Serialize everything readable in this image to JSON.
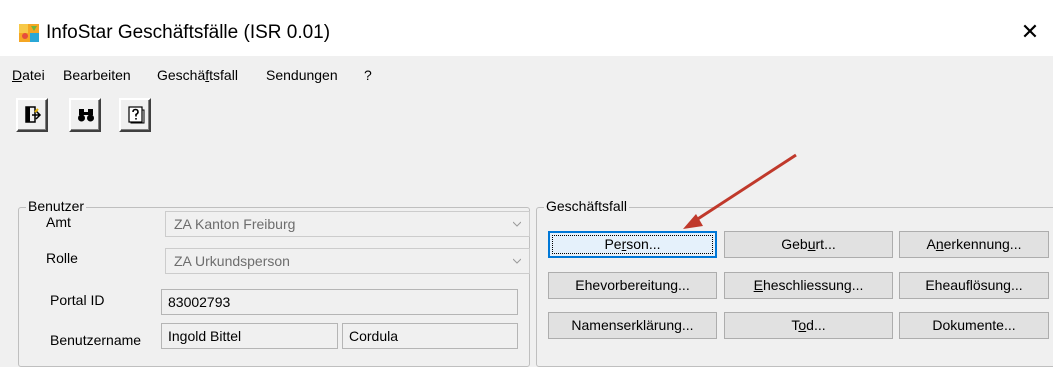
{
  "window": {
    "title": "InfoStar Geschäftsfälle (ISR 0.01)",
    "close_symbol": "✕",
    "app_icon": "infostar-app-icon"
  },
  "menu": {
    "items": [
      {
        "label": "Datei",
        "mnemonic": "D"
      },
      {
        "label": "Bearbeiten",
        "mnemonic": ""
      },
      {
        "label": "Geschäftsfall",
        "mnemonic": "f"
      },
      {
        "label": "Sendungen",
        "mnemonic": ""
      },
      {
        "label": "?",
        "mnemonic": ""
      }
    ]
  },
  "toolbar": {
    "buttons": [
      {
        "icon": "exit-door-icon"
      },
      {
        "icon": "binoculars-search-icon"
      },
      {
        "icon": "help-icon"
      }
    ]
  },
  "benutzer": {
    "legend": "Benutzer",
    "amt_label": "Amt",
    "amt_value": "ZA Kanton Freiburg",
    "rolle_label": "Rolle",
    "rolle_value": "ZA Urkundsperson",
    "portal_id_label": "Portal ID",
    "portal_id_value": "83002793",
    "benutzername_label": "Benutzername",
    "benutzername_last": "Ingold Bittel",
    "benutzername_first": "Cordula"
  },
  "geschaeftsfall": {
    "legend": "Geschäftsfall",
    "buttons": [
      {
        "label": "Person...",
        "mnemonic_index": 2
      },
      {
        "label": "Geburt...",
        "mnemonic_index": 3
      },
      {
        "label": "Anerkennung...",
        "mnemonic_index": 1
      },
      {
        "label": "Ehevorbereitung...",
        "mnemonic_index": -1
      },
      {
        "label": "Eheschliessung...",
        "mnemonic_index": 0
      },
      {
        "label": "Eheauflösung...",
        "mnemonic_index": -1
      },
      {
        "label": "Namenserklärung...",
        "mnemonic_index": -1
      },
      {
        "label": "Tod...",
        "mnemonic_index": 1
      },
      {
        "label": "Dokumente...",
        "mnemonic_index": -1
      }
    ]
  },
  "colors": {
    "annotation_arrow": "#c0392b",
    "focus_border": "#0078d7"
  }
}
